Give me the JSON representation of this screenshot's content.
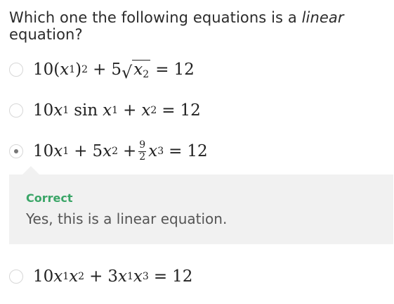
{
  "question": {
    "prefix": "Which one the following equations is a",
    "emphasis": "linear",
    "suffix": "equation?"
  },
  "options": [
    {
      "id": "opt1",
      "selected": false,
      "equation": "10(x1)^2 + 5√x2 = 12"
    },
    {
      "id": "opt2",
      "selected": false,
      "equation": "10x1 sin x1 + x2 = 12"
    },
    {
      "id": "opt3",
      "selected": true,
      "equation": "10x1 + 5x2 + (9/2) x3 = 12"
    },
    {
      "id": "opt4",
      "selected": false,
      "equation": "10x1x2 + 3x1x3 = 12"
    }
  ],
  "feedback": {
    "title": "Correct",
    "message": "Yes, this is a linear equation."
  },
  "colors": {
    "correct": "#3aa567",
    "feedback_bg": "#f1f1f1",
    "radio_border": "#d7d7d7"
  }
}
